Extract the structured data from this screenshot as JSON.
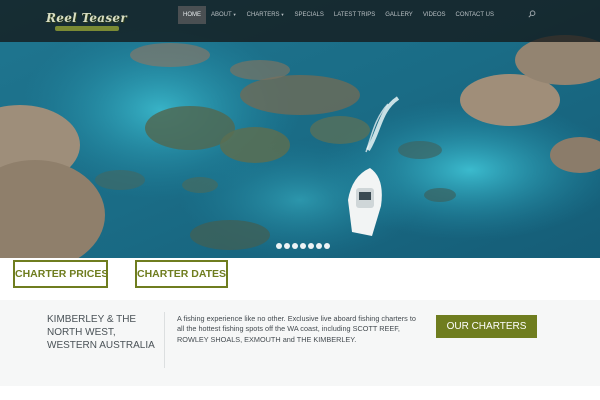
{
  "logo": {
    "text": "Reel Teaser",
    "tagline": "FISHING ADVENTURES"
  },
  "nav": {
    "items": [
      {
        "label": "HOME",
        "active": true,
        "dropdown": false
      },
      {
        "label": "ABOUT",
        "active": false,
        "dropdown": true
      },
      {
        "label": "CHARTERS",
        "active": false,
        "dropdown": true
      },
      {
        "label": "SPECIALS",
        "active": false,
        "dropdown": false
      },
      {
        "label": "LATEST TRIPS",
        "active": false,
        "dropdown": false
      },
      {
        "label": "GALLERY",
        "active": false,
        "dropdown": false
      },
      {
        "label": "VIDEOS",
        "active": false,
        "dropdown": false
      },
      {
        "label": "CONTACT US",
        "active": false,
        "dropdown": false
      }
    ],
    "search_icon": "search-icon"
  },
  "hero": {
    "slide_count": 7,
    "active_slide": 1
  },
  "buttons": {
    "prices_label": "CHARTER PRICES",
    "dates_label": "CHARTER DATES"
  },
  "info": {
    "region": "KIMBERLEY & THE NORTH WEST, WESTERN AUSTRALIA",
    "description": "A fishing experience like no other. Exclusive live aboard fishing charters to all the hottest fishing spots off the WA coast, including SCOTT REEF, ROWLEY SHOALS, EXMOUTH and THE KIMBERLEY.",
    "cta_label": "OUR CHARTERS"
  },
  "colors": {
    "accent": "#6f7d1f",
    "header_bg": "#14181a",
    "water": "#1b6f85"
  }
}
